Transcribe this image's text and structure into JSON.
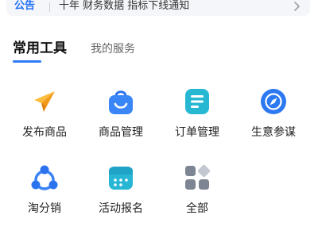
{
  "notice": {
    "tag": "公告",
    "text": "十年 财务数据 指标下线通知"
  },
  "tabs": [
    {
      "label": "常用工具",
      "active": true
    },
    {
      "label": "我的服务",
      "active": false
    }
  ],
  "tools": [
    {
      "label": "发布商品",
      "icon": "paper-plane-icon"
    },
    {
      "label": "商品管理",
      "icon": "shopping-bag-icon"
    },
    {
      "label": "订单管理",
      "icon": "order-list-icon"
    },
    {
      "label": "生意参谋",
      "icon": "compass-icon"
    },
    {
      "label": "淘分销",
      "icon": "distribution-network-icon"
    },
    {
      "label": "活动报名",
      "icon": "calendar-icon"
    },
    {
      "label": "全部",
      "icon": "all-apps-icon"
    }
  ],
  "colors": {
    "accent": "#2f7bf6",
    "orange": "#f7a623",
    "cyan": "#24b8d6"
  }
}
